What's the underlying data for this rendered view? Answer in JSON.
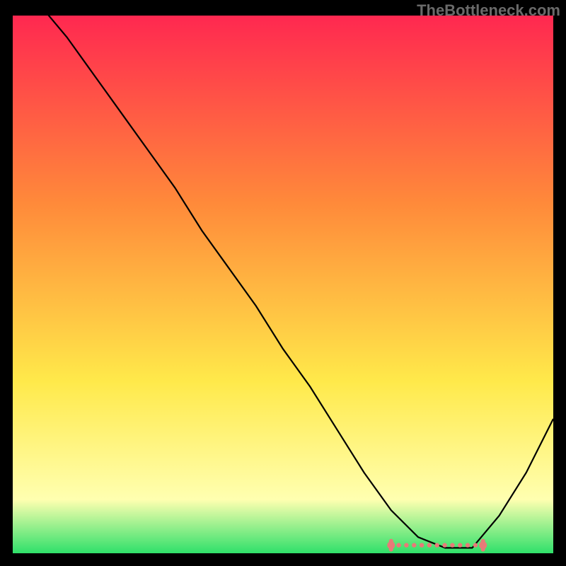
{
  "watermark": "TheBottleneck.com",
  "colors": {
    "bg": "#000000",
    "watermark": "#6a6a6a",
    "curve": "#000000",
    "marker": "#e87a78",
    "grad_top": "#ff2850",
    "grad_mid_top": "#ff8a3a",
    "grad_mid_bot": "#ffe94a",
    "grad_pale": "#ffffb0",
    "grad_bottom": "#2fe06a"
  },
  "chart_data": {
    "type": "line",
    "title": "",
    "xlabel": "",
    "ylabel": "",
    "xlim": [
      0,
      100
    ],
    "ylim": [
      0,
      100
    ],
    "grid": false,
    "series": [
      {
        "name": "curve",
        "x": [
          0,
          5,
          10,
          15,
          20,
          25,
          30,
          35,
          40,
          45,
          50,
          55,
          60,
          65,
          70,
          75,
          80,
          85,
          90,
          95,
          100
        ],
        "y": [
          108,
          102,
          96,
          89,
          82,
          75,
          68,
          60,
          53,
          46,
          38,
          31,
          23,
          15,
          8,
          3,
          1,
          1,
          7,
          15,
          25
        ]
      }
    ],
    "flat_segment": {
      "x_start": 70,
      "x_end": 87,
      "y": 1.5
    }
  }
}
